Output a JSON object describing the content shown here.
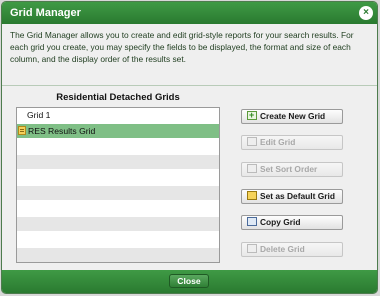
{
  "window": {
    "title": "Grid Manager",
    "close_glyph": "×"
  },
  "description": "The Grid Manager allows you to create and edit grid-style reports for your search results. For each grid you create, you may specify the fields to be displayed, the format and size of each column, and the display order of the results set.",
  "grids": {
    "title": "Residential Detached Grids",
    "items": [
      {
        "label": "Grid 1",
        "icon": "",
        "selected": false
      },
      {
        "label": "RES Results Grid",
        "icon": "document-icon",
        "selected": true
      }
    ],
    "empty_rows": 8
  },
  "buttons": [
    {
      "label": "Create New Grid",
      "icon": "create-grid-icon",
      "enabled": true
    },
    {
      "label": "Edit Grid",
      "icon": "edit-grid-icon",
      "enabled": false
    },
    {
      "label": "Set Sort Order",
      "icon": "sort-order-icon",
      "enabled": false
    },
    {
      "label": "Set as Default Grid",
      "icon": "default-grid-icon",
      "enabled": true
    },
    {
      "label": "Copy Grid",
      "icon": "copy-grid-icon",
      "enabled": true
    },
    {
      "label": "Delete Grid",
      "icon": "delete-grid-icon",
      "enabled": false
    }
  ],
  "footer": {
    "close_label": "Close"
  },
  "colors": {
    "title_bar": "#2a7a30",
    "selected_row": "#7fbf86"
  }
}
